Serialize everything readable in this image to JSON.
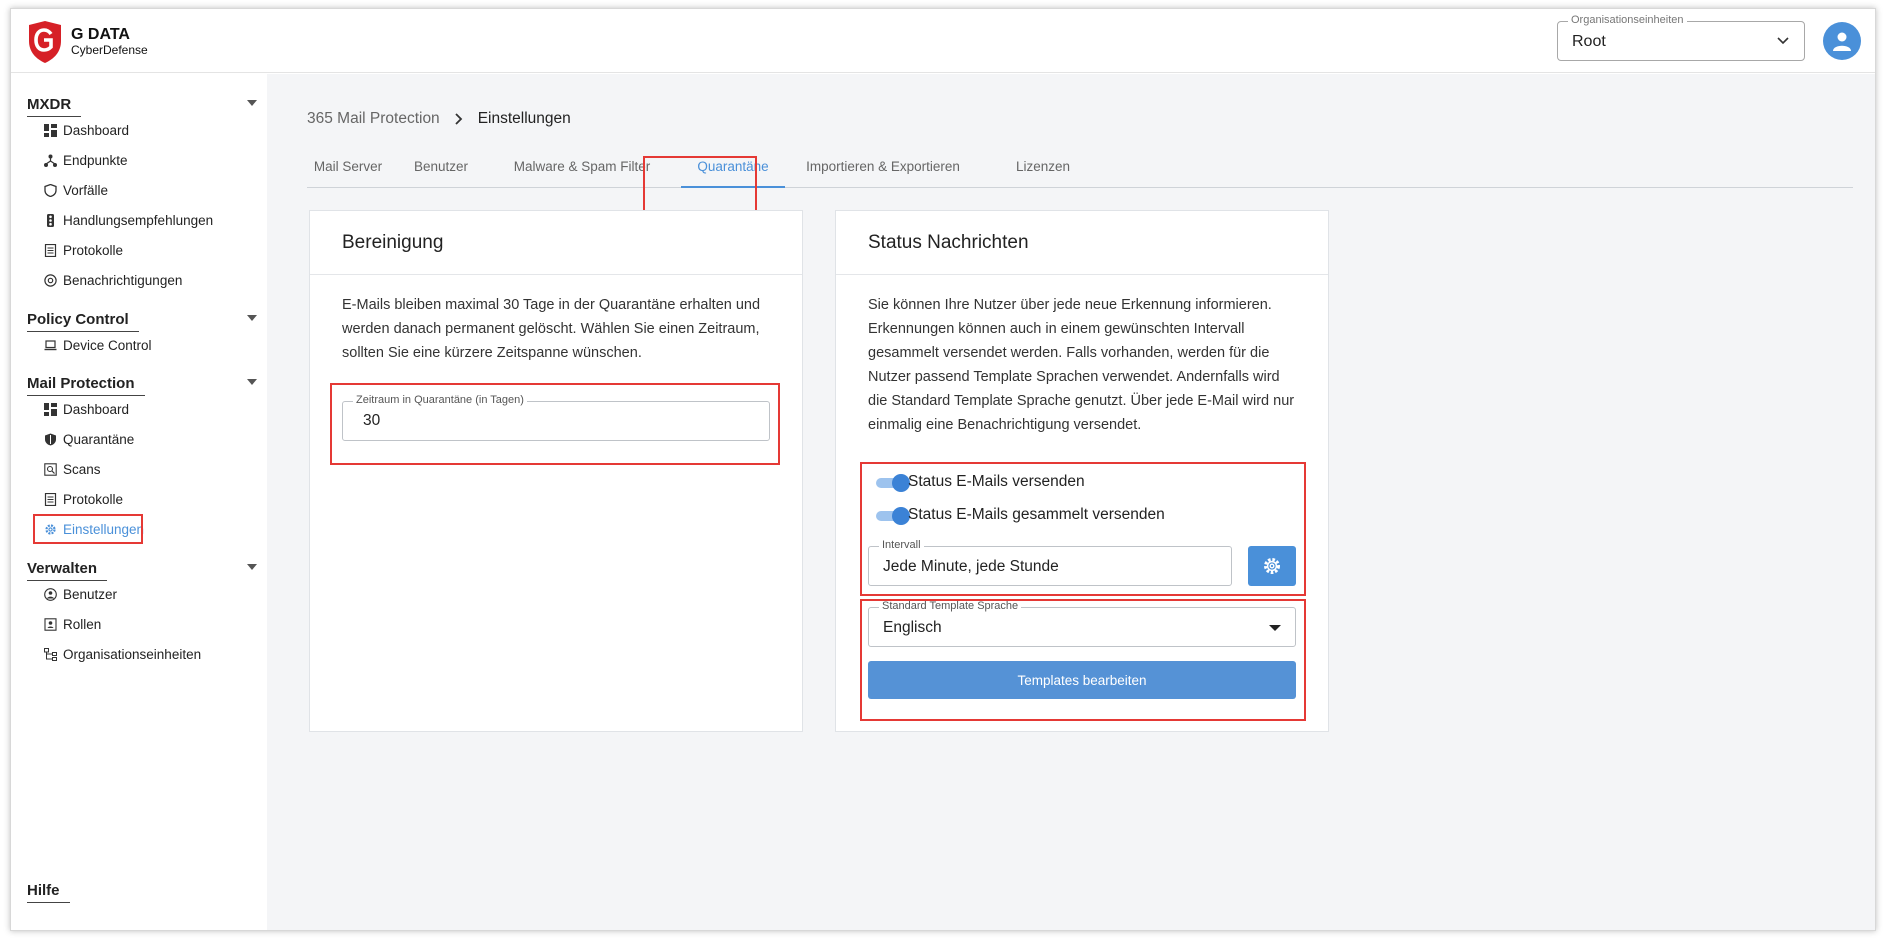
{
  "brand": {
    "line1": "G DATA",
    "line2": "CyberDefense"
  },
  "header": {
    "org_unit_label": "Organisationseinheiten",
    "org_unit_value": "Root"
  },
  "sidebar": {
    "sections": [
      {
        "title": "MXDR",
        "items": [
          "Dashboard",
          "Endpunkte",
          "Vorfälle",
          "Handlungsempfehlungen",
          "Protokolle",
          "Benachrichtigungen"
        ]
      },
      {
        "title": "Policy Control",
        "items": [
          "Device Control"
        ]
      },
      {
        "title": "Mail Protection",
        "items": [
          "Dashboard",
          "Quarantäne",
          "Scans",
          "Protokolle",
          "Einstellungen"
        ]
      },
      {
        "title": "Verwalten",
        "items": [
          "Benutzer",
          "Rollen",
          "Organisationseinheiten"
        ]
      },
      {
        "title": "Hilfe",
        "items": []
      }
    ],
    "active_item": "Einstellungen"
  },
  "breadcrumb": {
    "parent": "365 Mail Protection",
    "current": "Einstellungen"
  },
  "tabs": [
    "Mail Server",
    "Benutzer",
    "Malware & Spam Filter",
    "Quarantäne",
    "Importieren & Exportieren",
    "Lizenzen"
  ],
  "active_tab": "Quarantäne",
  "cleanup_card": {
    "title": "Bereinigung",
    "description": "E-Mails bleiben maximal 30 Tage in der Quarantäne erhalten und werden danach permanent gelöscht. Wählen Sie einen Zeitraum, sollten Sie eine kürzere Zeitspanne wünschen.",
    "field_label": "Zeitraum in Quarantäne (in Tagen)",
    "field_value": "30"
  },
  "status_card": {
    "title": "Status Nachrichten",
    "description": "Sie können Ihre Nutzer über jede neue Erkennung informieren. Erkennungen können auch in einem gewünschten Intervall gesammelt versendet werden. Falls vorhanden, werden für die Nutzer passend Template Sprachen verwendet. Andernfalls wird die Standard Template Sprache genutzt. Über jede E-Mail wird nur einmalig eine Benachrichtigung versendet.",
    "toggle1_label": "Status E-Mails versenden",
    "toggle1_on": true,
    "toggle2_label": "Status E-Mails gesammelt versenden",
    "toggle2_on": true,
    "interval_label": "Intervall",
    "interval_value": "Jede Minute, jede Stunde",
    "language_label": "Standard Template Sprache",
    "language_value": "Englisch",
    "templates_button": "Templates bearbeiten"
  },
  "colors": {
    "accent": "#4a90d9",
    "highlight": "#e53935",
    "brand_red": "#d62027"
  }
}
